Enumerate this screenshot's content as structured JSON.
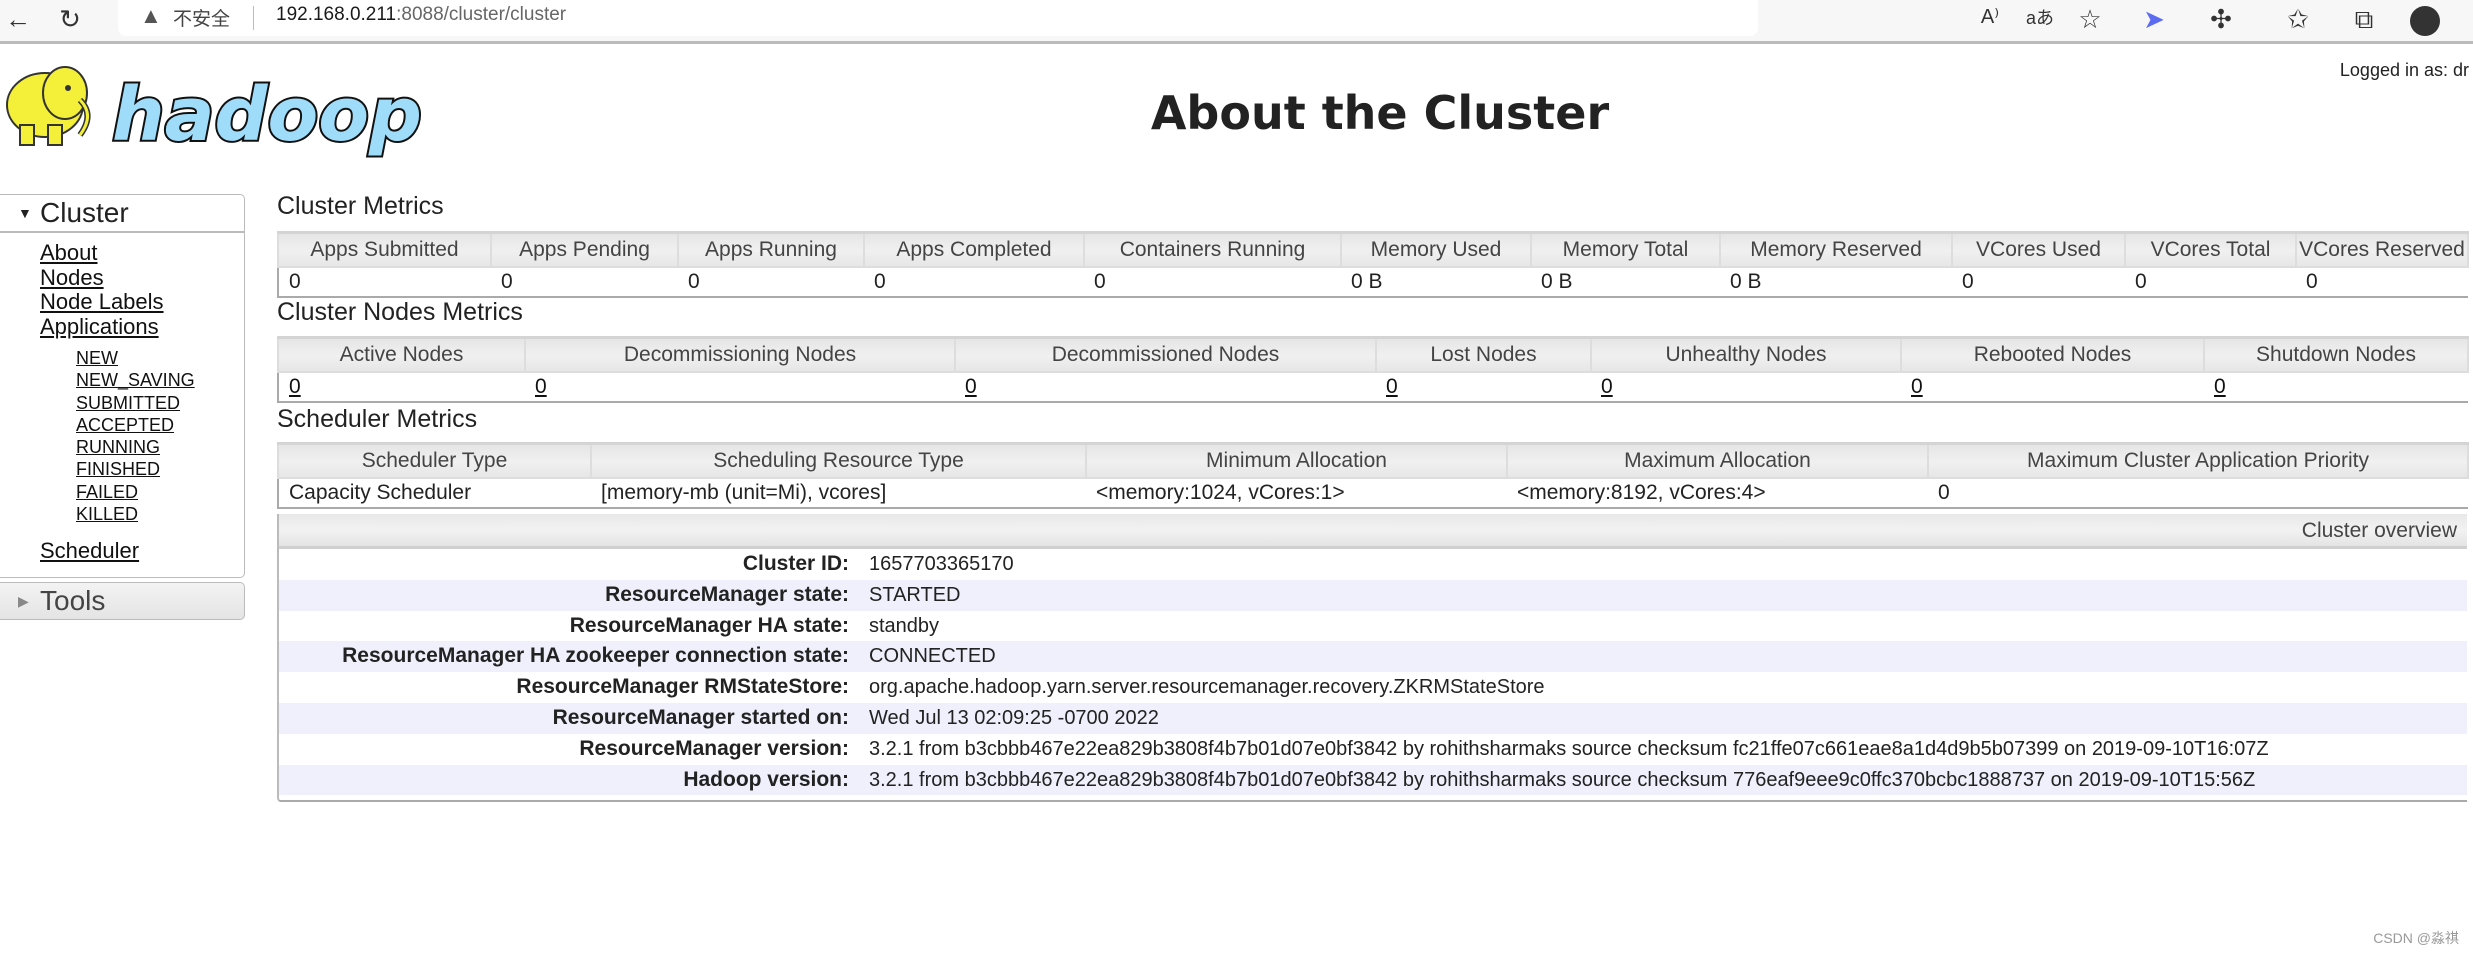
{
  "browser": {
    "security_label": "不安全",
    "url_host": "192.168.0.211",
    "url_rest": ":8088/cluster/cluster",
    "icons": [
      "back-icon",
      "reload-icon",
      "warning-icon",
      "read-aloud-icon",
      "translate-icon",
      "add-favorite-icon",
      "extension-icon",
      "puzzle-icon",
      "favorites-icon",
      "collections-icon",
      "profile-avatar"
    ]
  },
  "header": {
    "logo_text": "hadoop",
    "title": "About the Cluster",
    "logged_in": "Logged in as: dr"
  },
  "sidebar": {
    "cluster_label": "Cluster",
    "links": [
      "About",
      "Nodes",
      "Node Labels",
      "Applications"
    ],
    "app_states": [
      "NEW",
      "NEW_SAVING",
      "SUBMITTED",
      "ACCEPTED",
      "RUNNING",
      "FINISHED",
      "FAILED",
      "KILLED"
    ],
    "scheduler": "Scheduler",
    "tools_label": "Tools"
  },
  "cluster_metrics": {
    "title": "Cluster Metrics",
    "headers": [
      "Apps Submitted",
      "Apps Pending",
      "Apps Running",
      "Apps Completed",
      "Containers Running",
      "Memory Used",
      "Memory Total",
      "Memory Reserved",
      "VCores Used",
      "VCores Total",
      "VCores Reserved"
    ],
    "values": [
      "0",
      "0",
      "0",
      "0",
      "0",
      "0 B",
      "0 B",
      "0 B",
      "0",
      "0",
      "0"
    ]
  },
  "node_metrics": {
    "title": "Cluster Nodes Metrics",
    "headers": [
      "Active Nodes",
      "Decommissioning Nodes",
      "Decommissioned Nodes",
      "Lost Nodes",
      "Unhealthy Nodes",
      "Rebooted Nodes",
      "Shutdown Nodes"
    ],
    "values": [
      "0",
      "0",
      "0",
      "0",
      "0",
      "0",
      "0"
    ]
  },
  "scheduler_metrics": {
    "title": "Scheduler Metrics",
    "headers": [
      "Scheduler Type",
      "Scheduling Resource Type",
      "Minimum Allocation",
      "Maximum Allocation",
      "Maximum Cluster Application Priority"
    ],
    "values": [
      "Capacity Scheduler",
      "[memory-mb (unit=Mi), vcores]",
      "<memory:1024, vCores:1>",
      "<memory:8192, vCores:4>",
      "0"
    ]
  },
  "overview": {
    "title": "Cluster overview",
    "rows": [
      {
        "label": "Cluster ID:",
        "value": "1657703365170"
      },
      {
        "label": "ResourceManager state:",
        "value": "STARTED"
      },
      {
        "label": "ResourceManager HA state:",
        "value": "standby"
      },
      {
        "label": "ResourceManager HA zookeeper connection state:",
        "value": "CONNECTED"
      },
      {
        "label": "ResourceManager RMStateStore:",
        "value": "org.apache.hadoop.yarn.server.resourcemanager.recovery.ZKRMStateStore"
      },
      {
        "label": "ResourceManager started on:",
        "value": "Wed Jul 13 02:09:25 -0700 2022"
      },
      {
        "label": "ResourceManager version:",
        "value": "3.2.1 from b3cbbb467e22ea829b3808f4b7b01d07e0bf3842 by rohithsharmaks source checksum fc21ffe07c661eae8a1d4d9b5b07399 on 2019-09-10T16:07Z"
      },
      {
        "label": "Hadoop version:",
        "value": "3.2.1 from b3cbbb467e22ea829b3808f4b7b01d07e0bf3842 by rohithsharmaks source checksum 776eaf9eee9c0ffc370bcbc1888737 on 2019-09-10T15:56Z"
      }
    ]
  },
  "watermark": "CSDN @淼祺"
}
